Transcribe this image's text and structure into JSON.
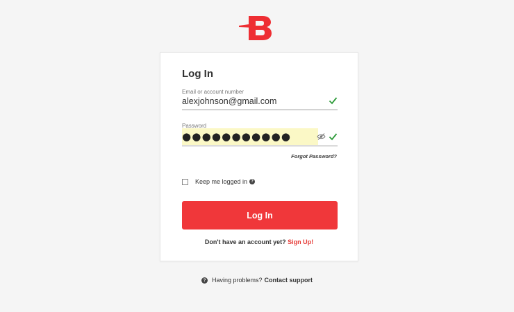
{
  "brand": {
    "logo_icon": "b-logo-icon",
    "accent_color": "#f0373a"
  },
  "login": {
    "title": "Log In",
    "email": {
      "label": "Email or account number",
      "value": "alexjohnson@gmail.com",
      "status": "valid"
    },
    "password": {
      "label": "Password",
      "masked_value": "●●●●●●●●●●●",
      "status": "valid",
      "autofill_bg": "#fbf8c6"
    },
    "forgot_password": "Forgot Password?",
    "keep_logged_in": {
      "label": "Keep me logged in",
      "checked": false
    },
    "submit_label": "Log In",
    "signup_prompt": "Don't have an account yet?",
    "signup_link": "Sign Up!"
  },
  "footer": {
    "problems_text": "Having problems?",
    "support_link": "Contact support"
  }
}
